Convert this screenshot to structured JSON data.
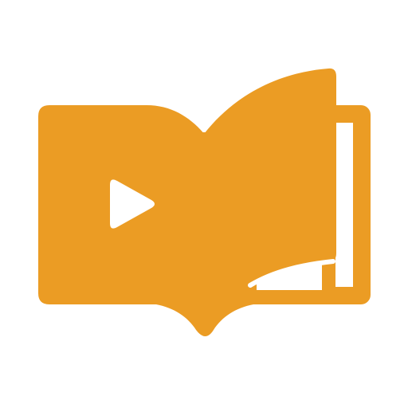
{
  "icon": {
    "name": "video-book-icon",
    "color": "#eb9c24",
    "background": "#ffffff"
  }
}
